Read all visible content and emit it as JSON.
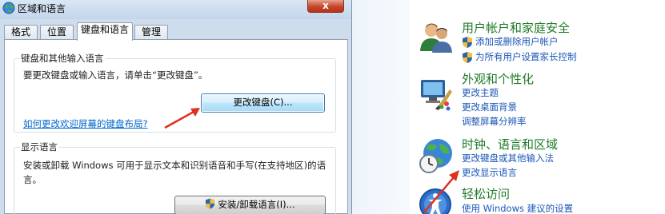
{
  "dialog": {
    "title": "区域和语言",
    "close_label": "x",
    "tabs": [
      {
        "label": "格式"
      },
      {
        "label": "位置"
      },
      {
        "label": "键盘和语言"
      },
      {
        "label": "管理"
      }
    ],
    "keyboard_group": {
      "title": "键盘和其他输入语言",
      "description": "要更改键盘或输入语言，请单击“更改键盘”。",
      "change_keyboard_button": "更改键盘(C)...",
      "welcome_screen_link": "如何更改欢迎屏幕的键盘布局?"
    },
    "display_group": {
      "title": "显示语言",
      "description_line1": "安装或卸载 Windows 可用于显示文本和识别语音和手写(在支持地区)的语",
      "description_line2": "言。",
      "install_button": "安装/卸载语言(I)..."
    }
  },
  "control_panel": {
    "user_accounts": {
      "heading": "用户帐户和家庭安全",
      "links": [
        "添加或删除用户帐户",
        "为所有用户设置家长控制"
      ]
    },
    "appearance": {
      "heading": "外观和个性化",
      "links": [
        "更改主题",
        "更改桌面背景",
        "调整屏幕分辨率"
      ]
    },
    "clock_region": {
      "heading": "时钟、语言和区域",
      "links": [
        "更改键盘或其他输入法",
        "更改显示语言"
      ]
    },
    "ease_of_access": {
      "heading": "轻松访问",
      "links": [
        "使用 Windows 建议的设置"
      ]
    }
  },
  "colors": {
    "annotation_arrow": "#e0301e",
    "link_blue": "#1a56b8",
    "heading_green": "#1e7a28"
  }
}
